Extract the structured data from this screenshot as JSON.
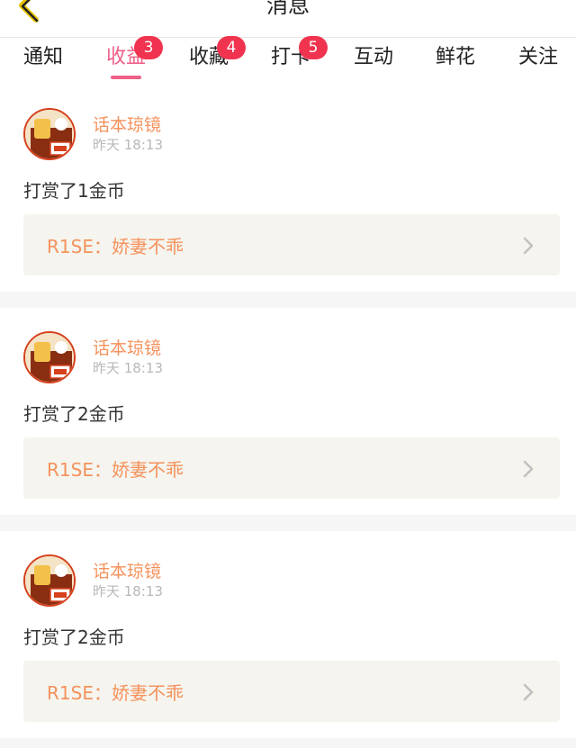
{
  "nav": {
    "title": "消息"
  },
  "tabs": [
    {
      "label": "通知",
      "badge": ""
    },
    {
      "label": "收益",
      "badge": "3"
    },
    {
      "label": "收藏",
      "badge": "4"
    },
    {
      "label": "打卡",
      "badge": "5"
    },
    {
      "label": "互动",
      "badge": ""
    },
    {
      "label": "鲜花",
      "badge": ""
    },
    {
      "label": "关注",
      "badge": ""
    }
  ],
  "active_tab": "收益",
  "colors": {
    "accent": "#ef5f87",
    "badge": "#f0344f",
    "orange": "#f5925c"
  },
  "feed": [
    {
      "name": "话本琼镜",
      "time": "昨天 18:13",
      "desc": "打赏了1金币",
      "link": "R1SE：娇妻不乖"
    },
    {
      "name": "话本琼镜",
      "time": "昨天 18:13",
      "desc": "打赏了2金币",
      "link": "R1SE：娇妻不乖"
    },
    {
      "name": "话本琼镜",
      "time": "昨天 18:13",
      "desc": "打赏了2金币",
      "link": "R1SE：娇妻不乖"
    }
  ]
}
